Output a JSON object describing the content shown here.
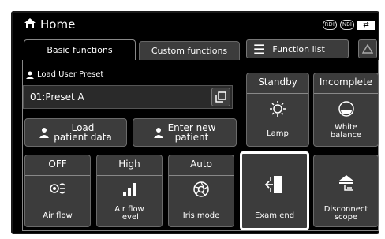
{
  "header": {
    "title": "Home",
    "badge_rdi": "RDI",
    "badge_nbi": "NBI"
  },
  "tabs": {
    "basic": "Basic functions",
    "custom": "Custom functions",
    "function_list": "Function list"
  },
  "preset": {
    "label": "Load User Preset",
    "value": "01:Preset A"
  },
  "patient": {
    "load": [
      "Load",
      "patient data"
    ],
    "enter": [
      "Enter new",
      "patient"
    ]
  },
  "standby": {
    "value": "Standby",
    "label": "Lamp"
  },
  "white_balance": {
    "value": "Incomplete",
    "label": [
      "White",
      "balance"
    ]
  },
  "airflow": {
    "value": "OFF",
    "label": "Air flow"
  },
  "airflow_level": {
    "value": "High",
    "label": [
      "Air flow",
      "level"
    ]
  },
  "iris": {
    "value": "Auto",
    "label": "Iris mode"
  },
  "exam_end": {
    "label": "Exam end"
  },
  "disconnect": {
    "label": [
      "Disconnect",
      "scope"
    ]
  },
  "icons": [
    "home-icon",
    "rdi-icon",
    "nbi-icon",
    "battery-icon",
    "menu-icon",
    "triangle-icon",
    "user-icon",
    "preset-copy-icon",
    "lamp-icon",
    "white-balance-icon",
    "air-flow-icon",
    "air-flow-level-icon",
    "iris-icon",
    "exam-end-icon",
    "disconnect-icon"
  ]
}
